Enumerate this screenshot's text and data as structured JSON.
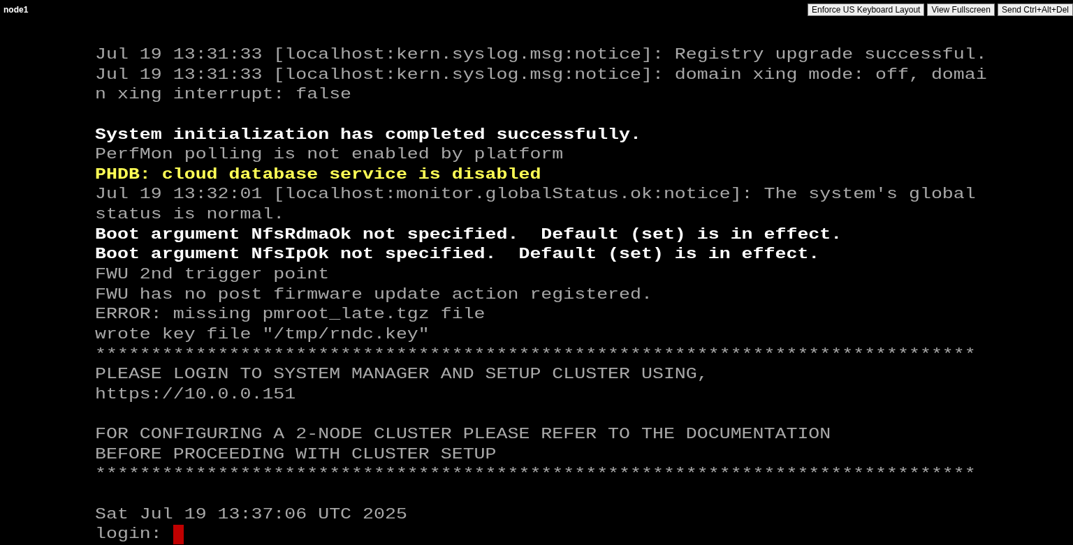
{
  "header": {
    "title": "node1",
    "buttons": [
      "Enforce US Keyboard Layout",
      "View Fullscreen",
      "Send Ctrl+Alt+Del"
    ]
  },
  "console": {
    "lines": [
      {
        "text": "Jul 19 13:31:33 [localhost:kern.syslog.msg:notice]: Registry upgrade successful.",
        "kind": "normal"
      },
      {
        "text": "Jul 19 13:31:33 [localhost:kern.syslog.msg:notice]: domain xing mode: off, domai",
        "kind": "normal"
      },
      {
        "text": "n xing interrupt: false",
        "kind": "normal"
      },
      {
        "text": "System initialization has completed successfully.",
        "kind": "bright",
        "gap_before": true
      },
      {
        "text": "PerfMon polling is not enabled by platform",
        "kind": "normal"
      },
      {
        "text": "PHDB: cloud database service is disabled",
        "kind": "warning"
      },
      {
        "text": "Jul 19 13:32:01 [localhost:monitor.globalStatus.ok:notice]: The system's global",
        "kind": "normal"
      },
      {
        "text": "status is normal.",
        "kind": "normal"
      },
      {
        "text": "Boot argument NfsRdmaOk not specified.  Default (set) is in effect.",
        "kind": "bright"
      },
      {
        "text": "Boot argument NfsIpOk not specified.  Default (set) is in effect.",
        "kind": "bright"
      },
      {
        "text": "FWU 2nd trigger point",
        "kind": "normal"
      },
      {
        "text": "FWU has no post firmware update action registered.",
        "kind": "normal"
      },
      {
        "text": "ERROR: missing pmroot_late.tgz file",
        "kind": "normal"
      },
      {
        "text": "wrote key file \"/tmp/rndc.key\"",
        "kind": "normal"
      },
      {
        "text": "*******************************************************************************",
        "kind": "normal"
      },
      {
        "text": "PLEASE LOGIN TO SYSTEM MANAGER AND SETUP CLUSTER USING,",
        "kind": "normal"
      },
      {
        "text": "https://10.0.0.151",
        "kind": "normal"
      },
      {
        "text": "FOR CONFIGURING A 2-NODE CLUSTER PLEASE REFER TO THE DOCUMENTATION",
        "kind": "normal",
        "gap_before": true
      },
      {
        "text": "BEFORE PROCEEDING WITH CLUSTER SETUP",
        "kind": "normal"
      },
      {
        "text": "*******************************************************************************",
        "kind": "normal"
      },
      {
        "text": "Sat Jul 19 13:37:06 UTC 2025",
        "kind": "normal",
        "gap_before": true
      },
      {
        "text": "login: ",
        "kind": "normal",
        "cursor": true
      }
    ]
  }
}
